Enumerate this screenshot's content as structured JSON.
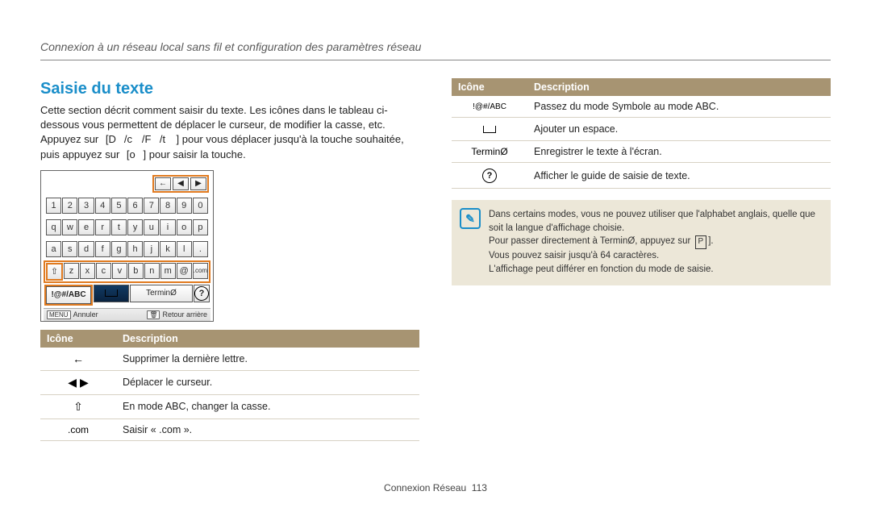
{
  "breadcrumb": "Connexion à un réseau local sans fil et configuration des paramètres réseau",
  "section_title": "Saisie du texte",
  "intro_a": "Cette section décrit comment saisir du texte. Les icônes dans le tableau ci-dessous vous permettent de déplacer le curseur, de modifier la casse, etc. Appuyez sur",
  "intro_keys_1": "[D",
  "intro_keys_2": "/c",
  "intro_keys_3": "/F",
  "intro_keys_4": "/t",
  "intro_b": "] pour vous déplacer jusqu'à la touche souhaitée, puis appuyez sur",
  "intro_c": "[o",
  "intro_d": "] pour saisir la touche.",
  "keyboard": {
    "top": [
      "←",
      "◀",
      "▶"
    ],
    "rows": [
      [
        "1",
        "2",
        "3",
        "4",
        "5",
        "6",
        "7",
        "8",
        "9",
        "0"
      ],
      [
        "q",
        "w",
        "e",
        "r",
        "t",
        "y",
        "u",
        "i",
        "o",
        "p"
      ],
      [
        "a",
        "s",
        "d",
        "f",
        "g",
        "h",
        "j",
        "k",
        "l",
        "."
      ],
      [
        "⇧",
        "z",
        "x",
        "c",
        "v",
        "b",
        "n",
        "m",
        "@",
        ".com"
      ]
    ],
    "bottom": {
      "mode": "!@#/ABC",
      "space_icon": "⌴",
      "term": "TerminØ",
      "help": "?"
    },
    "footer": {
      "menu_btn": "MENU",
      "menu_label": "Annuler",
      "back_btn": "🗑",
      "back_label": "Retour arrière"
    }
  },
  "table_headers": {
    "icon": "Icône",
    "desc": "Description"
  },
  "left_table": [
    {
      "icon": "←",
      "desc": "Supprimer la dernière lettre."
    },
    {
      "icon": "◀  ▶",
      "desc": "Déplacer le curseur."
    },
    {
      "icon": "⇧",
      "desc": "En mode ABC, changer la casse."
    },
    {
      "icon": ".com",
      "desc": "Saisir « .com »."
    }
  ],
  "right_table": [
    {
      "icon": "!@#/ABC",
      "desc": "Passez du mode Symbole au mode ABC."
    },
    {
      "icon": "SPACE",
      "desc": "Ajouter un espace."
    },
    {
      "icon": "TerminØ",
      "desc": "Enregistrer le texte à l'écran."
    },
    {
      "icon": "QMARK",
      "desc": "Afficher le guide de saisie de texte."
    }
  ],
  "note": {
    "l1": "Dans certains modes, vous ne pouvez utiliser que l'alphabet anglais, quelle que soit la langue d'affichage choisie.",
    "l2a": "Pour passer directement à TerminØ, appuyez sur ",
    "l2_btn": "P",
    "l2b": "].",
    "l3": "Vous pouvez saisir jusqu'à 64 caractères.",
    "l4": "L'affichage peut différer en fonction du mode de saisie."
  },
  "footer": {
    "section": "Connexion Réseau",
    "page": "113"
  }
}
